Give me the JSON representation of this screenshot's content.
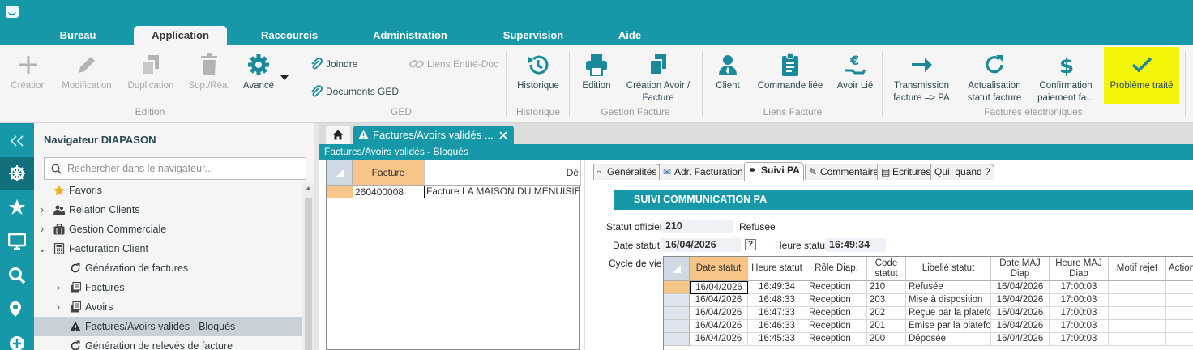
{
  "menu": {
    "tabs": [
      "Bureau",
      "Application",
      "Raccourcis",
      "Administration",
      "Supervision",
      "Aide"
    ],
    "active": "Application"
  },
  "ribbon": {
    "edition": {
      "label": "Edition",
      "buttons": [
        "Création",
        "Modification",
        "Duplication",
        "Sup./Réa.",
        "Avancé"
      ]
    },
    "ged": {
      "label": "GED",
      "joindre": "Joindre",
      "documents": "Documents GED",
      "liens": "Liens Entité-Doc"
    },
    "historique": {
      "label": "Historique",
      "button": "Historique"
    },
    "gestion_facture": {
      "label": "Gestion Facture",
      "edition": "Edition",
      "creation_avoir_1": "Création Avoir /",
      "creation_avoir_2": "Facture"
    },
    "liens_facture": {
      "label": "Liens Facture",
      "client": "Client",
      "commande": "Commande liée",
      "avoir": "Avoir Lié"
    },
    "factures_electroniques": {
      "label": "Factures électroniques",
      "transmission_1": "Transmission",
      "transmission_2": "facture => PA",
      "actualisation_1": "Actualisation",
      "actualisation_2": "statut facture",
      "confirmation_1": "Confirmation",
      "confirmation_2": "paiement  fa...",
      "probleme": "Problème traité"
    },
    "colors": {
      "highlight": "#f5f50a",
      "accent": "#1798a8"
    }
  },
  "navigator": {
    "title": "Navigateur DIAPASON",
    "search_placeholder": "Rechercher dans le navigateur...",
    "items": [
      {
        "label": "Favoris",
        "icon": "star-icon"
      },
      {
        "label": "Relation Clients",
        "icon": "people-icon"
      },
      {
        "label": "Gestion Commerciale",
        "icon": "briefcase-icon"
      },
      {
        "label": "Facturation Client",
        "icon": "calculator-icon"
      },
      {
        "label": "Génération de factures",
        "icon": "refresh-icon"
      },
      {
        "label": "Factures",
        "icon": "invoice-icon"
      },
      {
        "label": "Avoirs",
        "icon": "invoice-icon"
      },
      {
        "label": "Factures/Avoirs validés - Bloqués",
        "icon": "warning-icon"
      },
      {
        "label": "Génération de relevés de facture",
        "icon": "refresh-icon"
      }
    ]
  },
  "doc_tab": {
    "title": "Factures/Avoirs validés ...",
    "subtitle": "Factures/Avoirs validés - Bloqués"
  },
  "left_grid": {
    "headers": [
      "Facture",
      "Dé"
    ],
    "row": [
      "260400008",
      "Facture LA MAISON DU MENUISIER -"
    ]
  },
  "inner_tabs": [
    "Généralités",
    "Adr. Facturation",
    "Suivi PA",
    "Commentaire",
    "Ecritures",
    "Qui, quand ?"
  ],
  "suivi": {
    "section_title": "SUIVI COMMUNICATION PA",
    "statut_label": "Statut officiel",
    "statut_code": "210",
    "statut_text": "Refusée",
    "date_label": "Date statut",
    "date_value": "16/04/2026",
    "question": "?",
    "heure_label": "Heure statut",
    "heure_value": "16:49:34",
    "cycle_label": "Cycle de vie"
  },
  "cycle_grid": {
    "headers": [
      "Date statut",
      "Heure statut",
      "Rôle Diap.",
      "Code statut",
      "Libellé statut",
      "Date MAJ Diap",
      "Heure MAJ Diap",
      "Motif rejet",
      "Action"
    ],
    "rows": [
      [
        "16/04/2026",
        "16:49:34",
        "Reception",
        "210",
        "Refusée",
        "16/04/2026",
        "17:00:03",
        "",
        ""
      ],
      [
        "16/04/2026",
        "16:48:33",
        "Reception",
        "203",
        "Mise à disposition",
        "16/04/2026",
        "17:00:03",
        "",
        ""
      ],
      [
        "16/04/2026",
        "16:47:33",
        "Reception",
        "202",
        "Reçue par la plateform",
        "16/04/2026",
        "17:00:03",
        "",
        ""
      ],
      [
        "16/04/2026",
        "16:46:33",
        "Reception",
        "201",
        "Emise par la plateform",
        "16/04/2026",
        "17:00:03",
        "",
        ""
      ],
      [
        "16/04/2026",
        "16:45:33",
        "Reception",
        "200",
        "Déposée",
        "16/04/2026",
        "17:00:03",
        "",
        ""
      ]
    ]
  }
}
